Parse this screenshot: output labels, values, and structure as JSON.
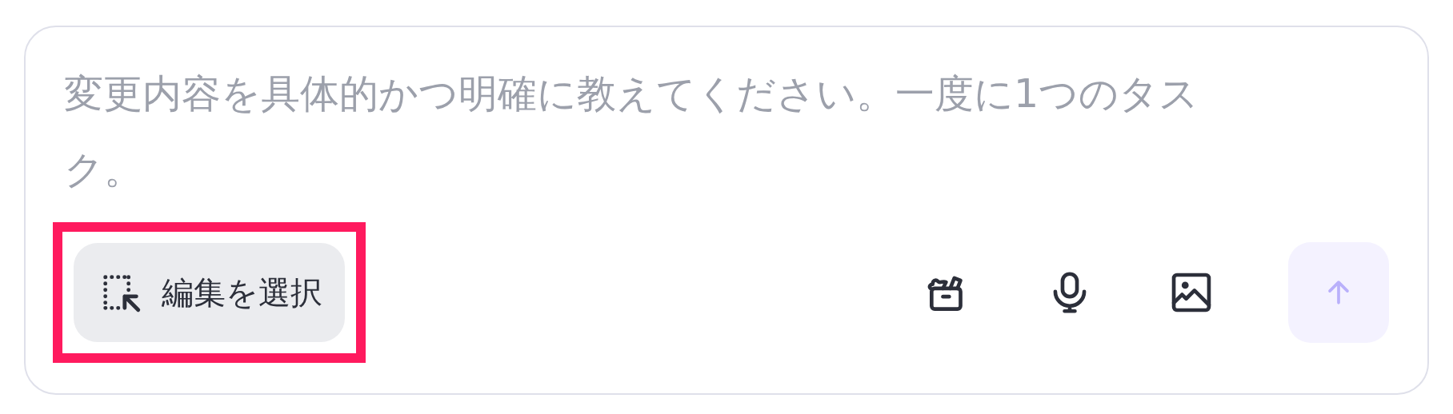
{
  "composer": {
    "placeholder": "変更内容を具体的かつ明確に教えてください。一度に1つのタスク。"
  },
  "select_button": {
    "label": "編集を選択",
    "highlighted": true
  },
  "tools": [
    {
      "kind": "toolbox"
    },
    {
      "kind": "mic"
    },
    {
      "kind": "image"
    }
  ],
  "send_button": {
    "disabled": true
  }
}
